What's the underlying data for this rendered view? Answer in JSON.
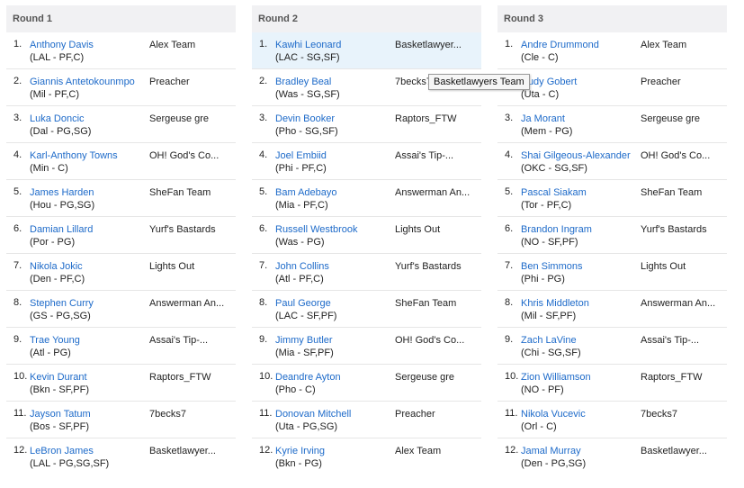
{
  "rounds": [
    {
      "label": "Round 1",
      "picks": [
        {
          "num": "1.",
          "player": "Anthony Davis",
          "info": "(LAL - PF,C)",
          "team": "Alex Team"
        },
        {
          "num": "2.",
          "player": "Giannis Antetokounmpo",
          "info": "(Mil - PF,C)",
          "team": "Preacher"
        },
        {
          "num": "3.",
          "player": "Luka Doncic",
          "info": "(Dal - PG,SG)",
          "team": "Sergeuse gre"
        },
        {
          "num": "4.",
          "player": "Karl-Anthony Towns",
          "info": "(Min - C)",
          "team": "OH! God's Co..."
        },
        {
          "num": "5.",
          "player": "James Harden",
          "info": "(Hou - PG,SG)",
          "team": "SheFan Team"
        },
        {
          "num": "6.",
          "player": "Damian Lillard",
          "info": "(Por - PG)",
          "team": "Yurf's Bastards"
        },
        {
          "num": "7.",
          "player": "Nikola Jokic",
          "info": "(Den - PF,C)",
          "team": "Lights Out"
        },
        {
          "num": "8.",
          "player": "Stephen Curry",
          "info": "(GS - PG,SG)",
          "team": "Answerman An..."
        },
        {
          "num": "9.",
          "player": "Trae Young",
          "info": "(Atl - PG)",
          "team": "Assai's Tip-..."
        },
        {
          "num": "10.",
          "player": "Kevin Durant",
          "info": "(Bkn - SF,PF)",
          "team": "Raptors_FTW"
        },
        {
          "num": "11.",
          "player": "Jayson Tatum",
          "info": "(Bos - SF,PF)",
          "team": "7becks7"
        },
        {
          "num": "12.",
          "player": "LeBron James",
          "info": "(LAL - PG,SG,SF)",
          "team": "Basketlawyer..."
        }
      ]
    },
    {
      "label": "Round 2",
      "picks": [
        {
          "num": "1.",
          "player": "Kawhi Leonard",
          "info": "(LAC - SG,SF)",
          "team": "Basketlawyer..."
        },
        {
          "num": "2.",
          "player": "Bradley Beal",
          "info": "(Was - SG,SF)",
          "team": "7becks7"
        },
        {
          "num": "3.",
          "player": "Devin Booker",
          "info": "(Pho - SG,SF)",
          "team": "Raptors_FTW"
        },
        {
          "num": "4.",
          "player": "Joel Embiid",
          "info": "(Phi - PF,C)",
          "team": "Assai's Tip-..."
        },
        {
          "num": "5.",
          "player": "Bam Adebayo",
          "info": "(Mia - PF,C)",
          "team": "Answerman An..."
        },
        {
          "num": "6.",
          "player": "Russell Westbrook",
          "info": "(Was - PG)",
          "team": "Lights Out"
        },
        {
          "num": "7.",
          "player": "John Collins",
          "info": "(Atl - PF,C)",
          "team": "Yurf's Bastards"
        },
        {
          "num": "8.",
          "player": "Paul George",
          "info": "(LAC - SF,PF)",
          "team": "SheFan Team"
        },
        {
          "num": "9.",
          "player": "Jimmy Butler",
          "info": "(Mia - SF,PF)",
          "team": "OH! God's Co..."
        },
        {
          "num": "10.",
          "player": "Deandre Ayton",
          "info": "(Pho - C)",
          "team": "Sergeuse gre"
        },
        {
          "num": "11.",
          "player": "Donovan Mitchell",
          "info": "(Uta - PG,SG)",
          "team": "Preacher"
        },
        {
          "num": "12.",
          "player": "Kyrie Irving",
          "info": "(Bkn - PG)",
          "team": "Alex Team"
        }
      ]
    },
    {
      "label": "Round 3",
      "picks": [
        {
          "num": "1.",
          "player": "Andre Drummond",
          "info": "(Cle - C)",
          "team": "Alex Team"
        },
        {
          "num": "2.",
          "player": "Rudy Gobert",
          "info": "(Uta - C)",
          "team": "Preacher"
        },
        {
          "num": "3.",
          "player": "Ja Morant",
          "info": "(Mem - PG)",
          "team": "Sergeuse gre"
        },
        {
          "num": "4.",
          "player": "Shai Gilgeous-Alexander",
          "info": "(OKC - SG,SF)",
          "team": "OH! God's Co..."
        },
        {
          "num": "5.",
          "player": "Pascal Siakam",
          "info": "(Tor - PF,C)",
          "team": "SheFan Team"
        },
        {
          "num": "6.",
          "player": "Brandon Ingram",
          "info": "(NO - SF,PF)",
          "team": "Yurf's Bastards"
        },
        {
          "num": "7.",
          "player": "Ben Simmons",
          "info": "(Phi - PG)",
          "team": "Lights Out"
        },
        {
          "num": "8.",
          "player": "Khris Middleton",
          "info": "(Mil - SF,PF)",
          "team": "Answerman An..."
        },
        {
          "num": "9.",
          "player": "Zach LaVine",
          "info": "(Chi - SG,SF)",
          "team": "Assai's Tip-..."
        },
        {
          "num": "10.",
          "player": "Zion Williamson",
          "info": "(NO - PF)",
          "team": "Raptors_FTW"
        },
        {
          "num": "11.",
          "player": "Nikola Vucevic",
          "info": "(Orl - C)",
          "team": "7becks7"
        },
        {
          "num": "12.",
          "player": "Jamal Murray",
          "info": "(Den - PG,SG)",
          "team": "Basketlawyer..."
        }
      ]
    }
  ],
  "tooltip": "Basketlawyers Team"
}
